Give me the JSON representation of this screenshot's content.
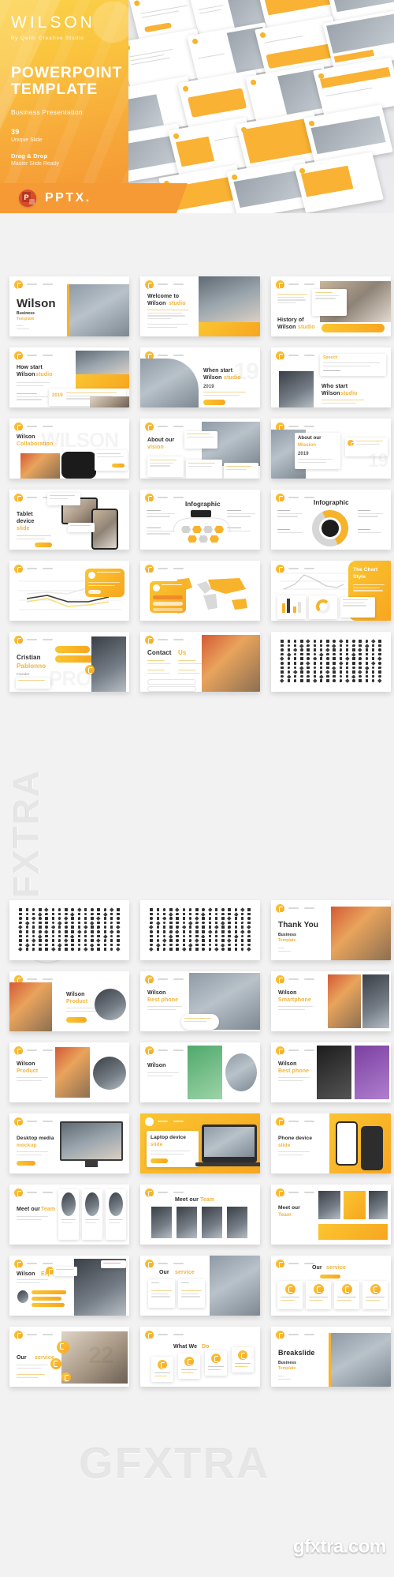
{
  "hero": {
    "brand": "WILSON",
    "by_prefix": "By",
    "by_author": "Qenti Creative Studio",
    "title_line1": "POWERPOINT",
    "title_line2": "TEMPLATE",
    "subtitle": "Business Presentation",
    "slide_count": "39",
    "slide_count_label": "Unique Slide",
    "feature_title": "Drag & Drop",
    "feature_sub": "Master Slide Ready",
    "format_label": "PPTX.",
    "format_icon": "powerpoint-icon",
    "accent_yellow": "#fbc531",
    "accent_orange": "#f59a35"
  },
  "watermarks": {
    "text_large": "GFXTRA",
    "url": "gfxtra.com"
  },
  "sections": [
    {
      "id": "section-one",
      "rows": [
        [
          {
            "title": "Wilson",
            "highlight": "",
            "sub1": "Business",
            "sub2": "Template",
            "layout": "title-photo"
          },
          {
            "title": "Welcome to",
            "highlight": "studio",
            "title2": "Wilson",
            "sub1": "",
            "sub2": "",
            "layout": "text-photo"
          },
          {
            "title": "History of",
            "highlight": "studio",
            "title2": "Wilson",
            "sub1": "",
            "sub2": "",
            "layout": "history"
          }
        ],
        [
          {
            "title": "How start",
            "title2": "Wilson",
            "highlight": "studio",
            "year": "2019",
            "layout": "howstart"
          },
          {
            "title": "When start",
            "title2": "Wilson",
            "highlight": "studio",
            "year": "2019",
            "layout": "whenstart"
          },
          {
            "title": "Who start",
            "title2": "Wilson",
            "highlight": "studio",
            "layout": "whostart"
          }
        ],
        [
          {
            "title": "Wilson",
            "highlight": "Collaboration",
            "layout": "collab"
          },
          {
            "title": "About our",
            "highlight": "vision",
            "layout": "vision"
          },
          {
            "title": "About our",
            "highlight": "Mission",
            "year": "2019",
            "layout": "mission"
          }
        ],
        [
          {
            "title": "Tablet",
            "title2": "device",
            "highlight": "slide",
            "layout": "tablet"
          },
          {
            "title": "Infographic",
            "layout": "info-hex"
          },
          {
            "title": "Infographic",
            "layout": "info-circle"
          }
        ],
        [
          {
            "title": "",
            "layout": "linechart"
          },
          {
            "title": "",
            "layout": "worldmap"
          },
          {
            "title": "The Chart",
            "title2": "Style",
            "layout": "chartstyle"
          }
        ],
        [
          {
            "title": "Cristian",
            "highlight": "Pablonno",
            "sub1": "Founder",
            "layout": "profile"
          },
          {
            "title": "Contact",
            "highlight": "Us",
            "layout": "contact"
          },
          {
            "title": "",
            "layout": "icon-grid"
          }
        ]
      ]
    },
    {
      "id": "section-two",
      "rows": [
        [
          {
            "title": "",
            "layout": "icon-grid"
          },
          {
            "title": "",
            "layout": "icon-grid"
          },
          {
            "title": "Thank You",
            "sub1": "Business",
            "sub2": "Template",
            "layout": "thankyou"
          }
        ],
        [
          {
            "title": "Wilson",
            "highlight": "Product",
            "layout": "prod-dark"
          },
          {
            "title": "Wilson",
            "highlight": "Best phone",
            "layout": "prod-watch"
          },
          {
            "title": "Wilson",
            "highlight": "Smartphone",
            "layout": "prod-colors"
          }
        ],
        [
          {
            "title": "Wilson",
            "highlight": "Product",
            "layout": "prod-grid"
          },
          {
            "title": "Wilson",
            "layout": "prod-green"
          },
          {
            "title": "Wilson",
            "highlight": "Best phone",
            "layout": "prod-purple"
          }
        ],
        [
          {
            "title": "Desktop media",
            "highlight": "mockup",
            "layout": "desktop"
          },
          {
            "title": "Laptop device",
            "highlight": "slide",
            "layout": "laptop"
          },
          {
            "title": "Phone device",
            "highlight": "slide",
            "layout": "phone"
          }
        ],
        [
          {
            "title": "Meet our",
            "highlight": "Team",
            "layout": "team-a"
          },
          {
            "title": "Meet our",
            "highlight": "Team",
            "layout": "team-b"
          },
          {
            "title": "Meet our",
            "highlight": "Team",
            "layout": "team-c"
          }
        ],
        [
          {
            "title": "Wilson",
            "highlight": "Expert",
            "layout": "expert"
          },
          {
            "title": "Our",
            "highlight": "service",
            "layout": "service-a"
          },
          {
            "title": "Our",
            "highlight": "service",
            "layout": "service-b"
          }
        ],
        [
          {
            "title": "Our",
            "highlight": "service",
            "layout": "service-c"
          },
          {
            "title": "What We",
            "highlight": "Do",
            "layout": "whatwedo"
          },
          {
            "title": "Breakslide",
            "sub1": "Business",
            "sub2": "Template",
            "layout": "breakslide"
          }
        ]
      ]
    }
  ]
}
